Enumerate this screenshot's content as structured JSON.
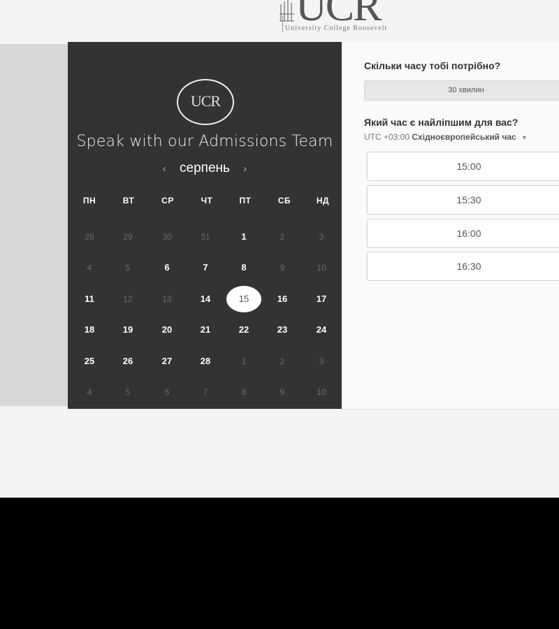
{
  "logo": {
    "letters": "UCR",
    "subtitle": "University College Roosevelt"
  },
  "calendar": {
    "title": "Speak with our Admissions Team",
    "month": "серпень",
    "prev_arrow": "‹",
    "next_arrow": "›",
    "weekdays": [
      "ПН",
      "ВТ",
      "СР",
      "ЧТ",
      "ПТ",
      "СБ",
      "НД"
    ],
    "weeks": [
      [
        {
          "d": "28",
          "s": "muted"
        },
        {
          "d": "29",
          "s": "muted"
        },
        {
          "d": "30",
          "s": "muted"
        },
        {
          "d": "31",
          "s": "muted"
        },
        {
          "d": "1",
          "s": "avail"
        },
        {
          "d": "2",
          "s": "muted"
        },
        {
          "d": "3",
          "s": "muted"
        }
      ],
      [
        {
          "d": "4",
          "s": "muted"
        },
        {
          "d": "5",
          "s": "muted"
        },
        {
          "d": "6",
          "s": "avail"
        },
        {
          "d": "7",
          "s": "avail"
        },
        {
          "d": "8",
          "s": "avail"
        },
        {
          "d": "9",
          "s": "muted"
        },
        {
          "d": "10",
          "s": "muted"
        }
      ],
      [
        {
          "d": "11",
          "s": "avail"
        },
        {
          "d": "12",
          "s": "muted"
        },
        {
          "d": "13",
          "s": "muted"
        },
        {
          "d": "14",
          "s": "avail"
        },
        {
          "d": "15",
          "s": "selected"
        },
        {
          "d": "16",
          "s": "avail"
        },
        {
          "d": "17",
          "s": "avail"
        }
      ],
      [
        {
          "d": "18",
          "s": "avail"
        },
        {
          "d": "19",
          "s": "avail"
        },
        {
          "d": "20",
          "s": "avail"
        },
        {
          "d": "21",
          "s": "avail"
        },
        {
          "d": "22",
          "s": "avail"
        },
        {
          "d": "23",
          "s": "avail"
        },
        {
          "d": "24",
          "s": "avail"
        }
      ],
      [
        {
          "d": "25",
          "s": "avail"
        },
        {
          "d": "26",
          "s": "avail"
        },
        {
          "d": "27",
          "s": "avail"
        },
        {
          "d": "28",
          "s": "avail"
        },
        {
          "d": "1",
          "s": "muted"
        },
        {
          "d": "2",
          "s": "muted"
        },
        {
          "d": "3",
          "s": "muted"
        }
      ],
      [
        {
          "d": "4",
          "s": "muted"
        },
        {
          "d": "5",
          "s": "muted"
        },
        {
          "d": "6",
          "s": "muted"
        },
        {
          "d": "7",
          "s": "muted"
        },
        {
          "d": "8",
          "s": "muted"
        },
        {
          "d": "9",
          "s": "muted"
        },
        {
          "d": "10",
          "s": "muted"
        }
      ]
    ]
  },
  "booking": {
    "duration_question": "Скільки часу тобі потрібно?",
    "duration_value": "30 хвилин",
    "time_question": "Який час є найліпшим для вас?",
    "timezone_offset": "UTC +03:00",
    "timezone_name": "Східноєвропейський час",
    "slots": [
      "15:00",
      "15:30",
      "16:00",
      "16:30"
    ]
  }
}
